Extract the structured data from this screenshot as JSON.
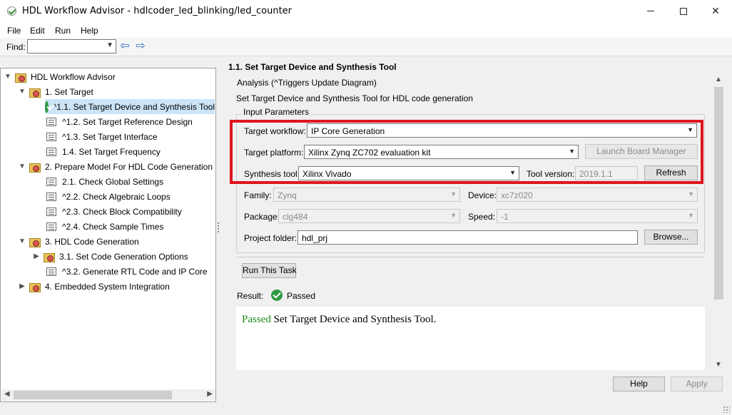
{
  "window": {
    "title": "HDL Workflow Advisor - hdlcoder_led_blinking/led_counter",
    "minimize": "—",
    "maximize": "☐",
    "close": "✕"
  },
  "menu": [
    "File",
    "Edit",
    "Run",
    "Help"
  ],
  "find": {
    "label": "Find:",
    "value": ""
  },
  "tree": [
    {
      "label": "HDL Workflow Advisor",
      "level": 0,
      "toggle": "expanded",
      "icon": "folder"
    },
    {
      "label": "1. Set Target",
      "level": 1,
      "toggle": "expanded",
      "icon": "folder"
    },
    {
      "label": "^1.1. Set Target Device and Synthesis Tool",
      "level": 2,
      "toggle": "none",
      "icon": "passed",
      "selected": true
    },
    {
      "label": "^1.2. Set Target Reference Design",
      "level": 2,
      "toggle": "none",
      "icon": "task"
    },
    {
      "label": "^1.3. Set Target Interface",
      "level": 2,
      "toggle": "none",
      "icon": "task"
    },
    {
      "label": "1.4. Set Target Frequency",
      "level": 2,
      "toggle": "none",
      "icon": "task"
    },
    {
      "label": "2. Prepare Model For HDL Code Generation",
      "level": 1,
      "toggle": "expanded",
      "icon": "folder"
    },
    {
      "label": "2.1. Check Global Settings",
      "level": 2,
      "toggle": "none",
      "icon": "task"
    },
    {
      "label": "^2.2. Check Algebraic Loops",
      "level": 2,
      "toggle": "none",
      "icon": "task"
    },
    {
      "label": "^2.3. Check Block Compatibility",
      "level": 2,
      "toggle": "none",
      "icon": "task"
    },
    {
      "label": "^2.4. Check Sample Times",
      "level": 2,
      "toggle": "none",
      "icon": "task"
    },
    {
      "label": "3. HDL Code Generation",
      "level": 1,
      "toggle": "expanded",
      "icon": "folder"
    },
    {
      "label": "3.1. Set Code Generation Options",
      "level": 2,
      "toggle": "collapsed",
      "icon": "folder"
    },
    {
      "label": "^3.2. Generate RTL Code and IP Core",
      "level": 2,
      "toggle": "none",
      "icon": "task"
    },
    {
      "label": "4. Embedded System Integration",
      "level": 1,
      "toggle": "collapsed",
      "icon": "folder"
    }
  ],
  "panel": {
    "title": "1.1. Set Target Device and Synthesis Tool",
    "analysis": "Analysis (^Triggers Update Diagram)",
    "description": "Set Target Device and Synthesis Tool for HDL code generation",
    "group_title": "Input Parameters",
    "target_workflow": {
      "label": "Target workflow:",
      "value": "IP Core Generation"
    },
    "target_platform": {
      "label": "Target platform:",
      "value": "Xilinx Zynq ZC702 evaluation kit"
    },
    "launch_board_manager": "Launch Board Manager",
    "synthesis_tool": {
      "label": "Synthesis tool:",
      "value": "Xilinx Vivado"
    },
    "tool_version": {
      "label": "Tool version:",
      "value": "2019.1.1"
    },
    "refresh": "Refresh",
    "family": {
      "label": "Family:",
      "value": "Zynq"
    },
    "device": {
      "label": "Device:",
      "value": "xc7z020"
    },
    "package": {
      "label": "Package:",
      "value": "clg484"
    },
    "speed": {
      "label": "Speed:",
      "value": "-1"
    },
    "project_folder": {
      "label": "Project folder:",
      "value": "hdl_prj"
    },
    "browse": "Browse...",
    "run_task": "Run This Task",
    "result_label": "Result:",
    "result_value": "Passed",
    "result_message_status": "Passed",
    "result_message_text": " Set Target Device and Synthesis Tool."
  },
  "footer": {
    "help": "Help",
    "apply": "Apply"
  },
  "colors": {
    "highlight": "#e0141e",
    "passed": "#2e9a44",
    "selected_row": "#cce4f7"
  }
}
